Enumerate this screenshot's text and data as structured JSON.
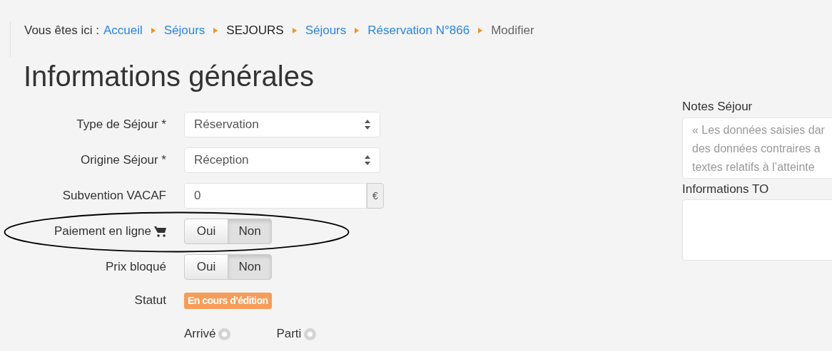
{
  "breadcrumb": {
    "prefix": "Vous êtes ici :",
    "items": [
      {
        "label": "Accueil",
        "kind": "link"
      },
      {
        "label": "Séjours",
        "kind": "link"
      },
      {
        "label": "SEJOURS",
        "kind": "text"
      },
      {
        "label": "Séjours",
        "kind": "link"
      },
      {
        "label": "Réservation N°866",
        "kind": "link"
      },
      {
        "label": "Modifier",
        "kind": "current"
      }
    ]
  },
  "title": "Informations générales",
  "form": [
    {
      "kind": "select",
      "label": "Type de Séjour *",
      "value": "Réservation"
    },
    {
      "kind": "select",
      "label": "Origine Séjour *",
      "value": "Réception"
    },
    {
      "kind": "amount",
      "label": "Subvention VACAF",
      "value": "0",
      "unit": "€"
    },
    {
      "kind": "toggle",
      "label": "Paiement en ligne",
      "cart_icon": true,
      "options": [
        {
          "label": "Oui",
          "selected": false
        },
        {
          "label": "Non",
          "selected": true
        }
      ]
    },
    {
      "kind": "toggle",
      "label": "Prix bloqué",
      "cart_icon": false,
      "options": [
        {
          "label": "Oui",
          "selected": false
        },
        {
          "label": "Non",
          "selected": true
        }
      ]
    },
    {
      "kind": "badge",
      "label": "Statut",
      "value": "En cours d'édition",
      "color": "#f79c59"
    },
    {
      "kind": "radios",
      "options": [
        {
          "label": "Arrivé",
          "checked": false
        },
        {
          "label": "Parti",
          "checked": false
        }
      ]
    }
  ],
  "notes": {
    "label": "Notes Séjour",
    "lines": [
      "« Les données saisies dar",
      "des données contraires a",
      "textes relatifs à l’atteinte"
    ]
  },
  "info_to": {
    "label": "Informations TO"
  }
}
